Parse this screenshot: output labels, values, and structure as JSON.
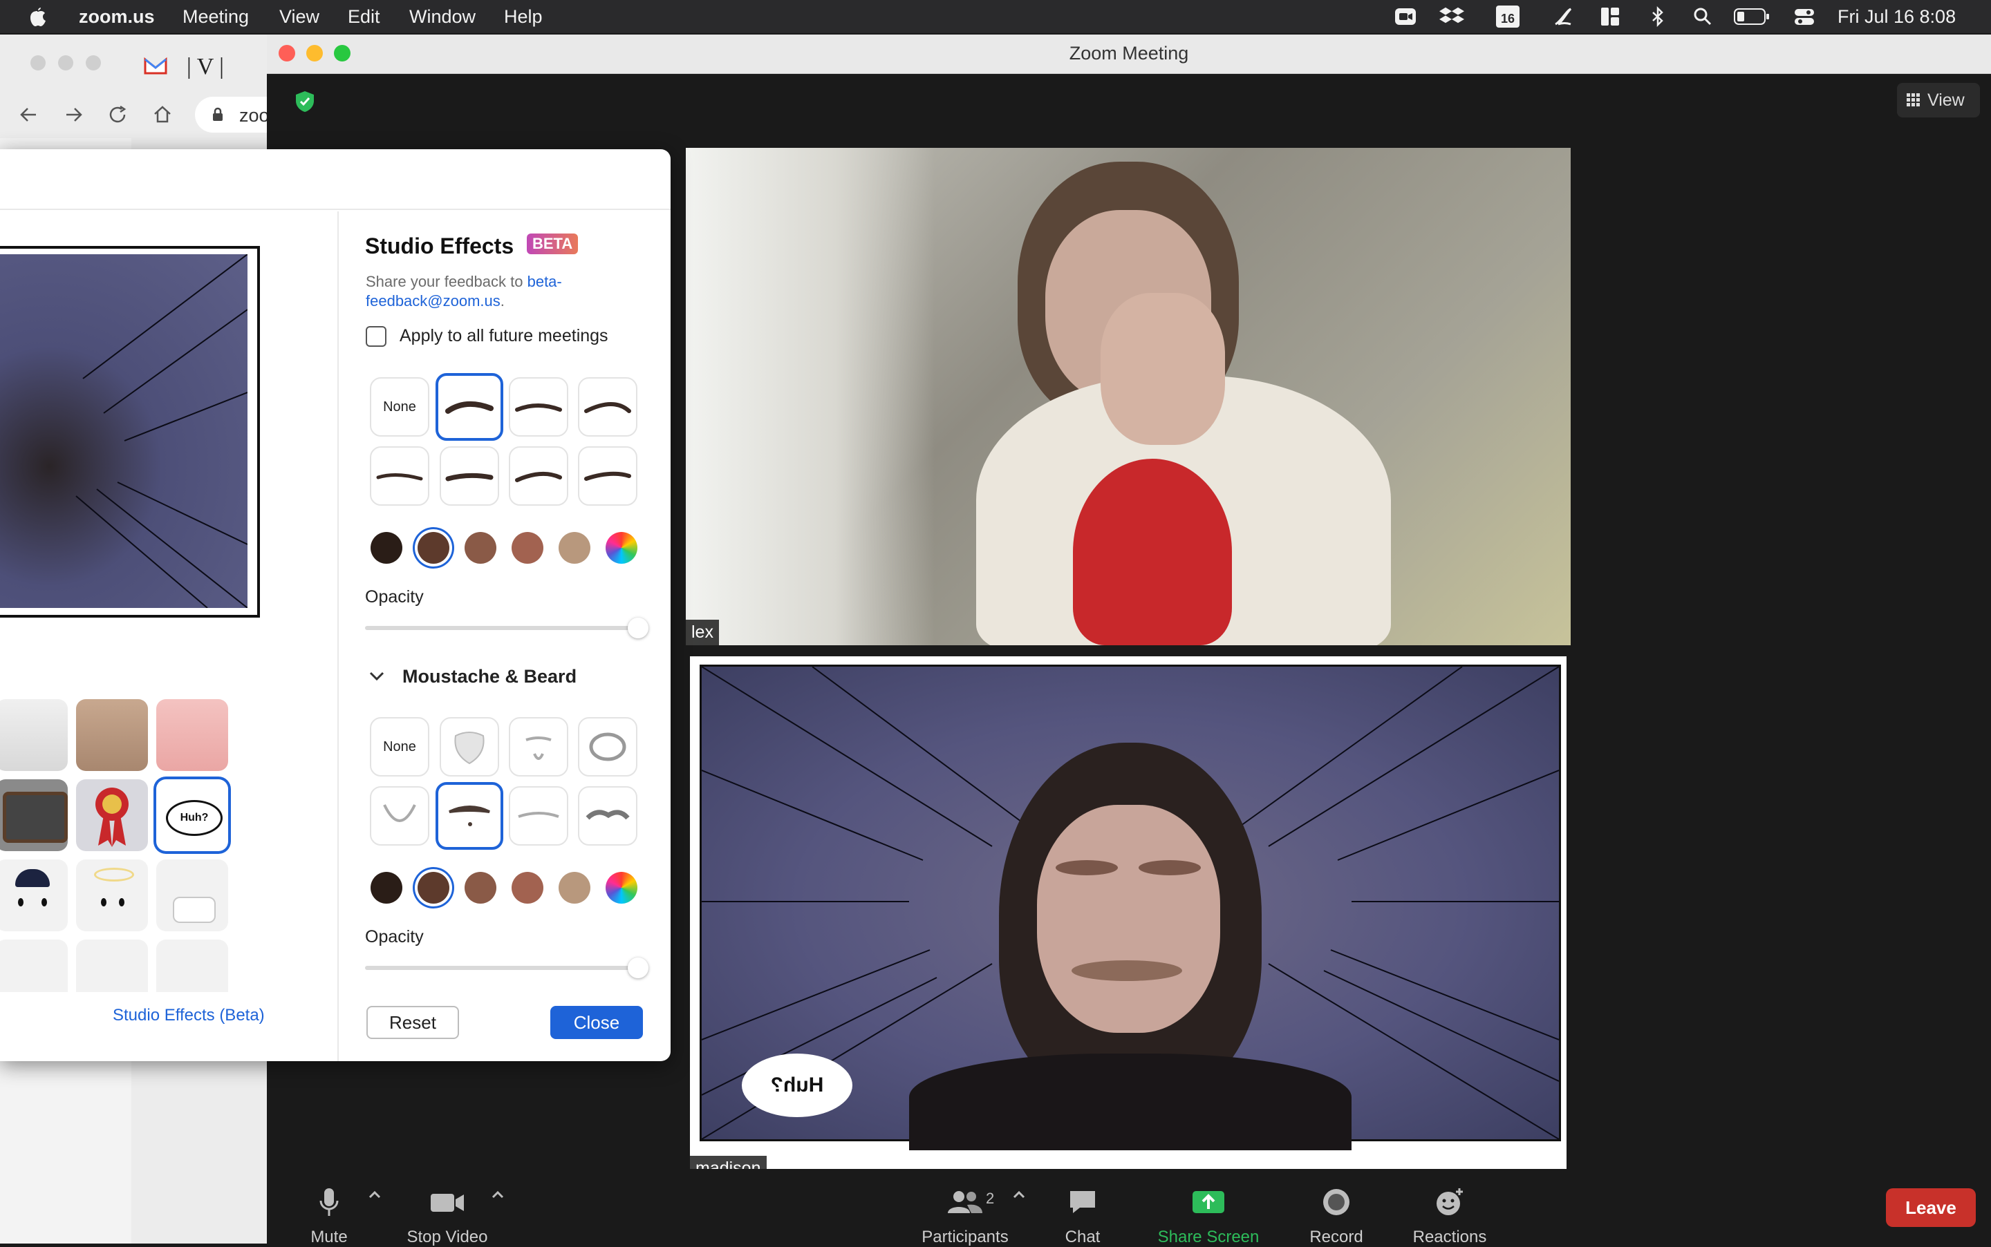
{
  "menubar": {
    "apple": "",
    "app_name": "zoom.us",
    "items": [
      "Meeting",
      "View",
      "Edit",
      "Window",
      "Help"
    ],
    "calendar_icon_text": "16",
    "datetime": "Fri Jul 16  8:08"
  },
  "browser": {
    "address_fragment": "zoo"
  },
  "zoom": {
    "window_title": "Zoom Meeting",
    "view_label": "View",
    "participants": [
      {
        "name": "lex"
      },
      {
        "name": "madison",
        "speech_bubble": "Huh?"
      }
    ],
    "toolbar": {
      "mute": "Mute",
      "stop_video": "Stop Video",
      "participants": "Participants",
      "participants_count": "2",
      "chat": "Chat",
      "share_screen": "Share Screen",
      "record": "Record",
      "reactions": "Reactions",
      "leave": "Leave"
    },
    "colors": {
      "leave": "#c8312a",
      "share": "#2dbc5a",
      "accent": "#1e63d8"
    }
  },
  "studio": {
    "title": "Studio Effects",
    "badge": "BETA",
    "feedback_prefix": "Share your feedback to ",
    "feedback_email_line1": "beta-",
    "feedback_email_line2": "feedback@zoom.us",
    "feedback_suffix": ".",
    "apply_all_label": "Apply to all future meetings",
    "apply_all_checked": false,
    "eyebrows_none": "None",
    "opacity_label": "Opacity",
    "opacity_value": 1.0,
    "moustache_section": "Moustache & Beard",
    "moustache_none": "None",
    "moustache_opacity_label": "Opacity",
    "moustache_opacity_value": 1.0,
    "reset_label": "Reset",
    "close_label": "Close",
    "studio_link": "Studio Effects (Beta)",
    "sticker_bubble": "Huh?",
    "swatch_colors": [
      "#2a1d17",
      "#5d3a2c",
      "#8a5a47",
      "#a26250",
      "#b8987d"
    ]
  }
}
